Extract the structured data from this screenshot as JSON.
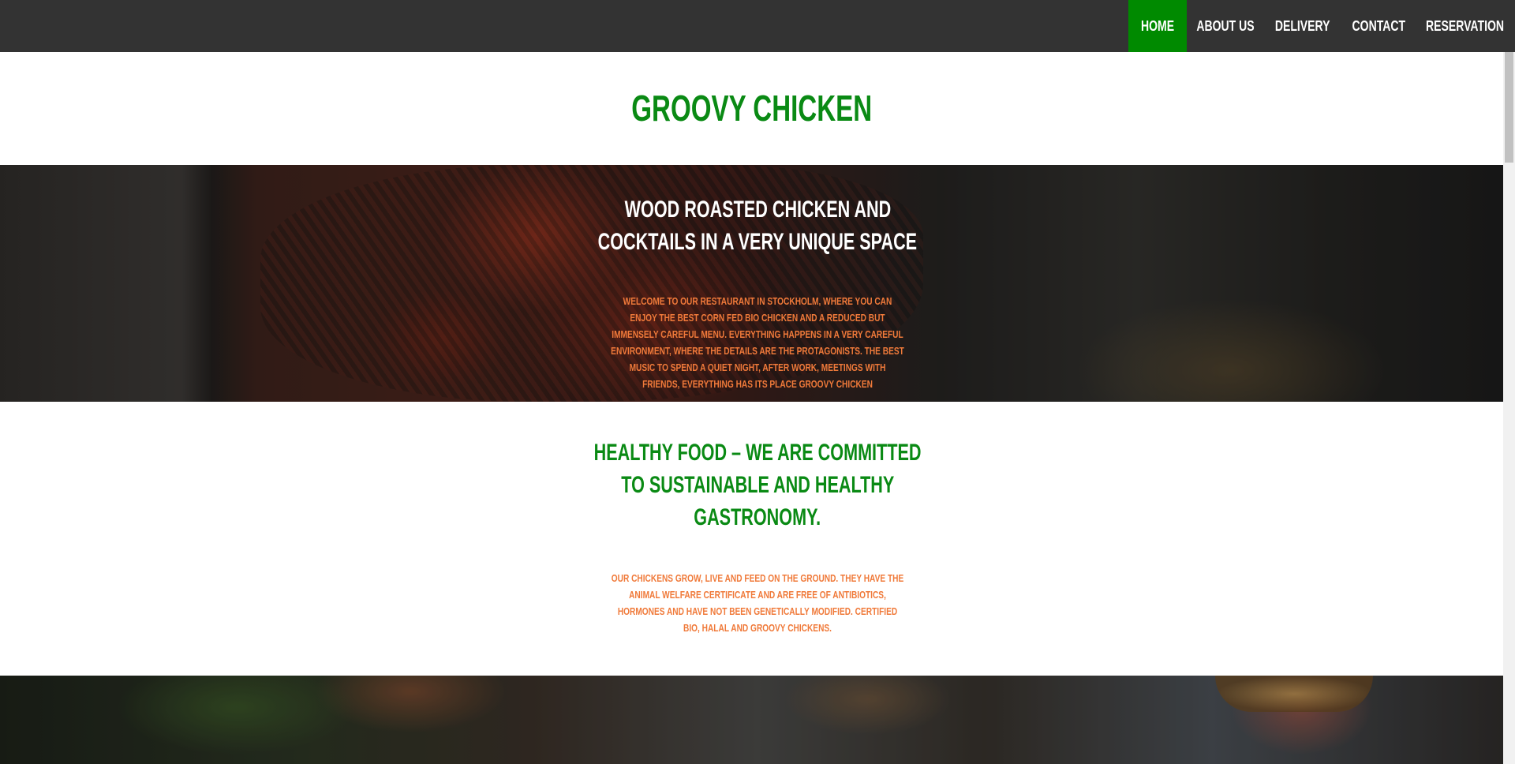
{
  "nav": {
    "items": [
      {
        "label": "HOME",
        "active": true
      },
      {
        "label": "ABOUT US",
        "active": false
      },
      {
        "label": "DELIVERY",
        "active": false
      },
      {
        "label": "CONTACT",
        "active": false
      },
      {
        "label": "RESERVATION",
        "active": false
      }
    ]
  },
  "header": {
    "title": "GROOVY CHICKEN"
  },
  "hero": {
    "heading_line1": "WOOD ROASTED CHICKEN AND",
    "heading_line2": "COCKTAILS IN A VERY UNIQUE SPACE",
    "text": "WELCOME TO OUR RESTAURANT IN STOCKHOLM, WHERE YOU CAN ENJOY THE BEST CORN FED BIO CHICKEN AND A REDUCED BUT IMMENSELY CAREFUL MENU. EVERYTHING HAPPENS IN A VERY CAREFUL ENVIRONMENT, WHERE THE DETAILS ARE THE PROTAGONISTS. THE BEST MUSIC TO SPEND A QUIET NIGHT, AFTER WORK, MEETINGS WITH FRIENDS, EVERYTHING HAS ITS PLACE GROOVY CHICKEN"
  },
  "healthy": {
    "heading_line1": "HEALTHY FOOD – WE ARE COMMITTED",
    "heading_line2": "TO SUSTAINABLE AND HEALTHY",
    "heading_line3": "GASTRONOMY.",
    "text": "OUR CHICKENS GROW, LIVE AND FEED ON THE GROUND. THEY HAVE THE ANIMAL WELFARE CERTIFICATE AND ARE FREE OF ANTIBIOTICS, HORMONES AND HAVE NOT BEEN GENETICALLY MODIFIED. CERTIFIED BIO, HALAL AND GROOVY CHICKENS."
  },
  "colors": {
    "nav_bg": "#333333",
    "nav_active": "#008a00",
    "title_green": "#0a8a14",
    "body_orange": "#f07a3a"
  }
}
